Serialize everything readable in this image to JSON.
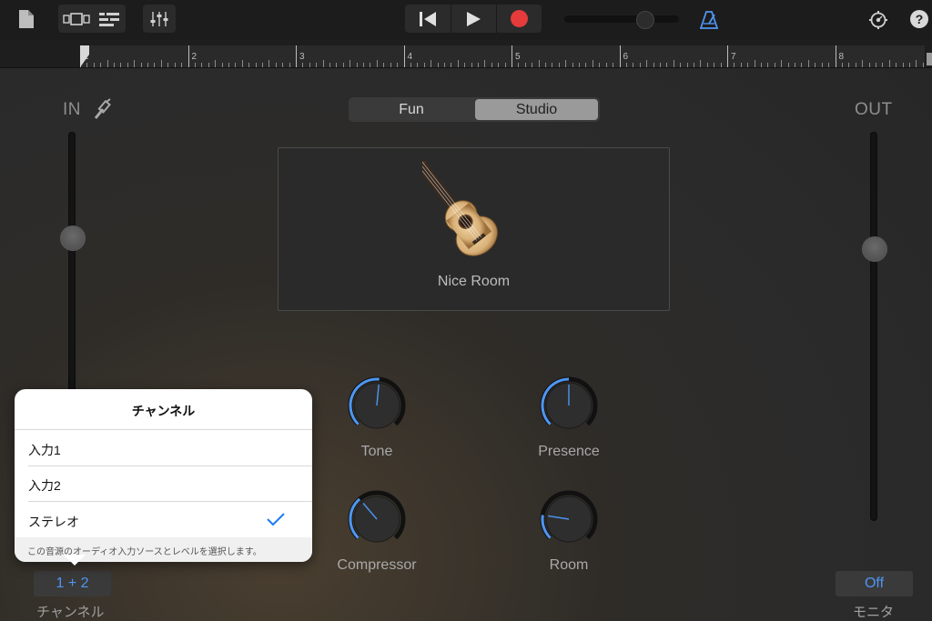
{
  "toolbar": {
    "icons": [
      "document-icon",
      "track-view-icon",
      "list-view-icon",
      "mixer-icon",
      "rewind-icon",
      "play-icon",
      "record-icon",
      "metronome-icon",
      "settings-icon",
      "help-icon"
    ],
    "help_label": "?",
    "volume": 0.7,
    "record_color": "#e53b3b",
    "accent_color": "#4e96f2"
  },
  "ruler": {
    "bars": [
      "1",
      "2",
      "3",
      "4",
      "5",
      "6",
      "7",
      "8"
    ]
  },
  "input": {
    "label": "IN",
    "level": 0.6,
    "channel_value": "1 + 2",
    "channel_label": "チャンネル"
  },
  "output": {
    "label": "OUT",
    "level": 0.7,
    "monitor_value": "Off",
    "monitor_label": "モニタ"
  },
  "mode_tabs": [
    {
      "label": "Fun",
      "active": false
    },
    {
      "label": "Studio",
      "active": true
    }
  ],
  "preset": {
    "name": "Nice Room",
    "icon": "acoustic-guitar-icon"
  },
  "knobs": [
    {
      "label": "Tone",
      "value": 0.52
    },
    {
      "label": "Presence",
      "value": 0.5
    },
    {
      "label": "Compressor",
      "value": 0.35
    },
    {
      "label": "Room",
      "value": 0.2
    }
  ],
  "channel_popover": {
    "title": "チャンネル",
    "items": [
      {
        "label": "入力1",
        "selected": false
      },
      {
        "label": "入力2",
        "selected": false
      },
      {
        "label": "ステレオ",
        "selected": true
      }
    ],
    "footer": "この音源のオーディオ入力ソースとレベルを選択します。"
  }
}
